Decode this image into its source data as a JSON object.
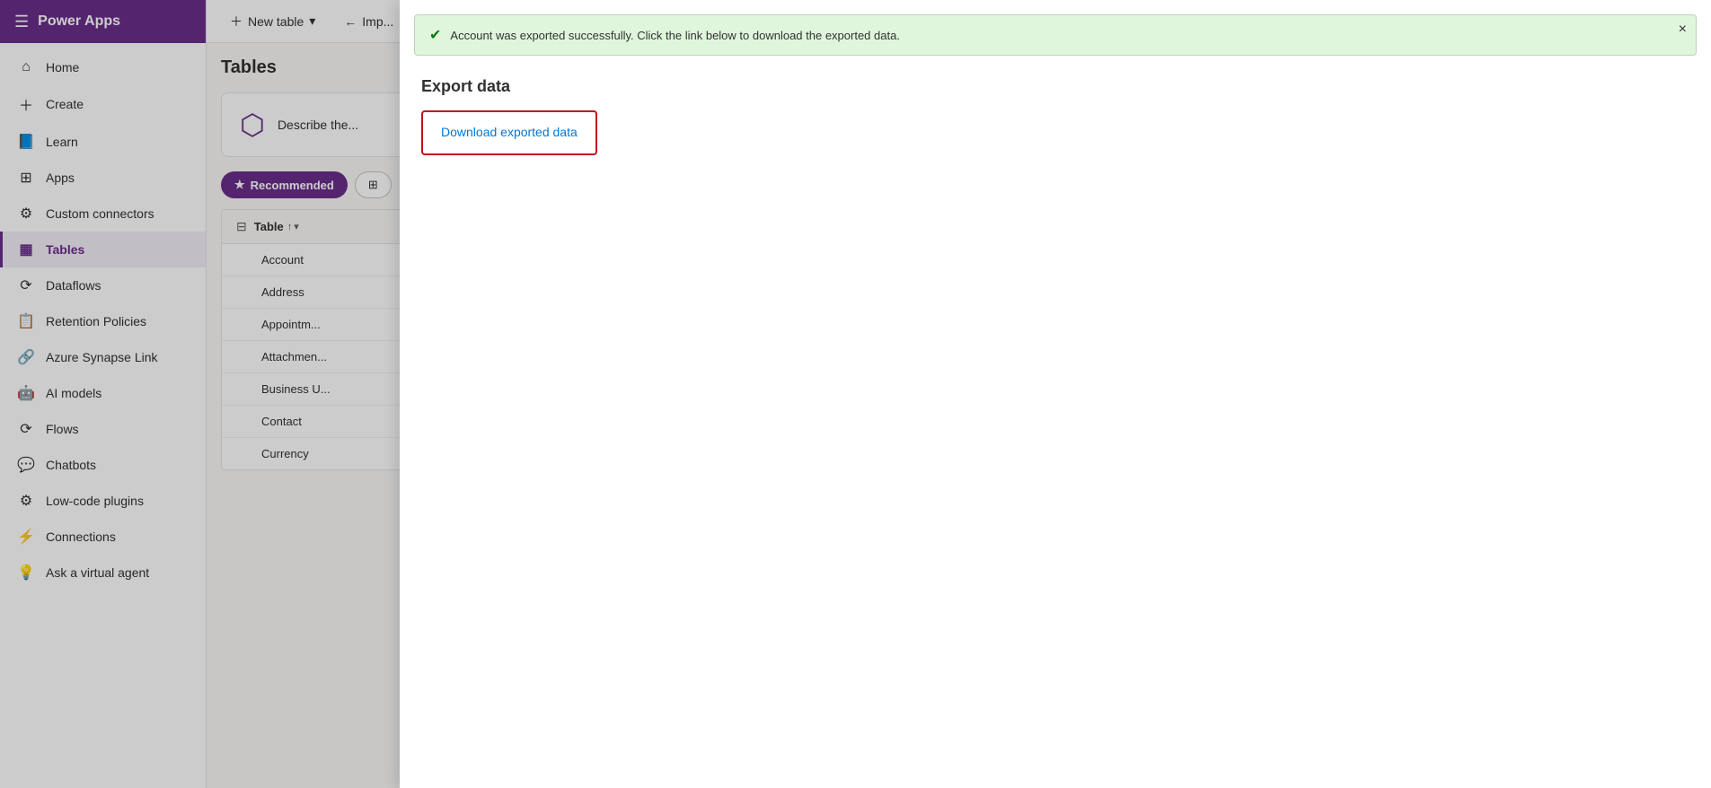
{
  "app": {
    "title": "Power Apps"
  },
  "sidebar": {
    "collapse_label": "Collapse",
    "items": [
      {
        "id": "home",
        "label": "Home",
        "icon": "⌂",
        "active": false
      },
      {
        "id": "create",
        "label": "Create",
        "icon": "+",
        "active": false
      },
      {
        "id": "learn",
        "label": "Learn",
        "icon": "📖",
        "active": false
      },
      {
        "id": "apps",
        "label": "Apps",
        "icon": "⊞",
        "active": false
      },
      {
        "id": "custom-connectors",
        "label": "Custom connectors",
        "icon": "⚙",
        "active": false
      },
      {
        "id": "tables",
        "label": "Tables",
        "icon": "⊞",
        "active": true
      },
      {
        "id": "dataflows",
        "label": "Dataflows",
        "icon": "↻",
        "active": false
      },
      {
        "id": "retention-policies",
        "label": "Retention Policies",
        "icon": "🔒",
        "active": false
      },
      {
        "id": "azure-synapse",
        "label": "Azure Synapse Link",
        "icon": "🔗",
        "active": false
      },
      {
        "id": "ai-models",
        "label": "AI models",
        "icon": "🤖",
        "active": false
      },
      {
        "id": "flows",
        "label": "Flows",
        "icon": "⟳",
        "active": false
      },
      {
        "id": "chatbots",
        "label": "Chatbots",
        "icon": "💬",
        "active": false
      },
      {
        "id": "low-code",
        "label": "Low-code plugins",
        "icon": "🔌",
        "active": false
      },
      {
        "id": "connections",
        "label": "Connections",
        "icon": "🔗",
        "active": false
      },
      {
        "id": "virtual-agent",
        "label": "Ask a virtual agent",
        "icon": "💡",
        "active": false
      }
    ]
  },
  "topbar": {
    "new_table_label": "New table",
    "import_label": "Imp..."
  },
  "page": {
    "title": "Tables",
    "describe_placeholder": "Describe the...",
    "filter_tabs": [
      {
        "id": "recommended",
        "label": "Recommended",
        "active": true
      },
      {
        "id": "all",
        "label": "",
        "active": false
      }
    ],
    "table_col_label": "Table",
    "table_rows": [
      "Account",
      "Address",
      "Appointm...",
      "Attachmen...",
      "Business U...",
      "Contact",
      "Currency"
    ]
  },
  "toast": {
    "message": "Account was exported successfully. Click the link below to download the exported data.",
    "close_label": "×"
  },
  "panel": {
    "close_label": "×",
    "section_title": "Export data",
    "download_link_label": "Download exported data"
  }
}
